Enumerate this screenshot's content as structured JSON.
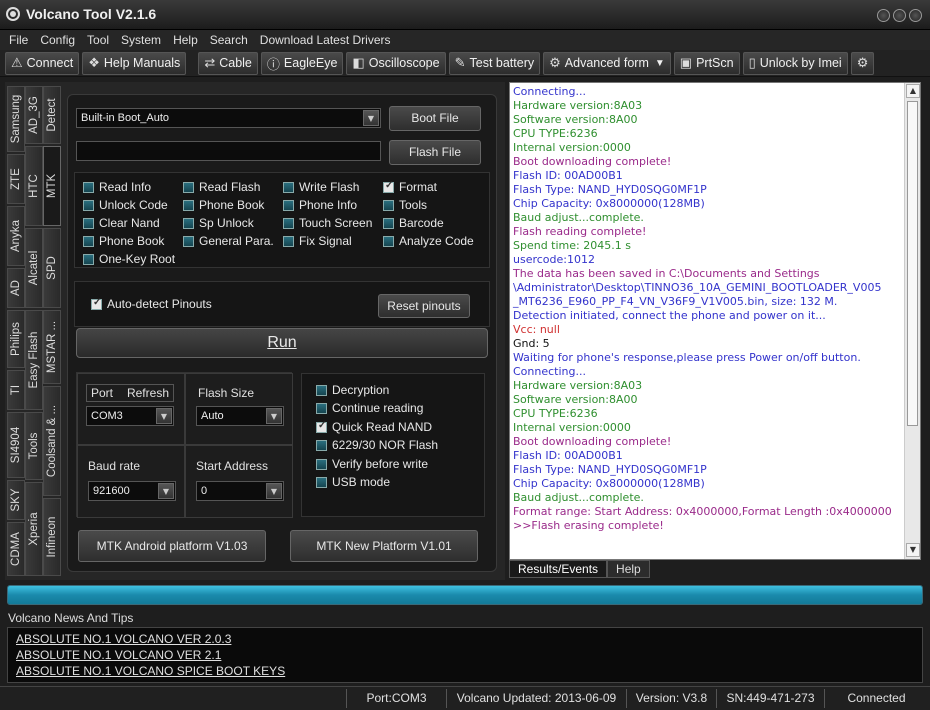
{
  "window": {
    "title": "Volcano Tool V2.1.6"
  },
  "menu": [
    "File",
    "Config",
    "Tool",
    "System",
    "Help",
    "Search",
    "Download Latest Drivers"
  ],
  "toolbar": {
    "connect": "Connect",
    "help_manuals": "Help Manuals",
    "cable": "Cable",
    "eagleeye": "EagleEye",
    "oscilloscope": "Oscilloscope",
    "test_battery": "Test battery",
    "advanced_form": "Advanced form",
    "prtscn": "PrtScn",
    "unlock_imei": "Unlock by Imei"
  },
  "side_tabs": {
    "col1": [
      "Samsung",
      "ZTE",
      "Anyka",
      "AD",
      "Philips",
      "TI",
      "SI4904",
      "SKY",
      "CDMA"
    ],
    "col2": [
      "AD_3G",
      "HTC",
      "Alcatel",
      "Easy Flash",
      "Tools",
      "Xperia"
    ],
    "col3": [
      "Detect",
      "MTK",
      "SPD",
      "MSTAR ...",
      "Coolsand & ...",
      "Infineon"
    ]
  },
  "boot": {
    "selected": "Built-in Boot_Auto",
    "boot_file": "Boot File",
    "flash_file": "Flash File",
    "flash_path": ""
  },
  "functions": [
    {
      "label": "Read Info",
      "checked": false
    },
    {
      "label": "Read Flash",
      "checked": false
    },
    {
      "label": "Write Flash",
      "checked": false
    },
    {
      "label": "Format",
      "checked": true
    },
    {
      "label": "Unlock Code",
      "checked": false
    },
    {
      "label": "Phone Book",
      "checked": false
    },
    {
      "label": "Phone Info",
      "checked": false
    },
    {
      "label": "Tools",
      "checked": false
    },
    {
      "label": "Clear Nand",
      "checked": false
    },
    {
      "label": "Sp Unlock",
      "checked": false
    },
    {
      "label": "Touch Screen",
      "checked": false
    },
    {
      "label": "Barcode",
      "checked": false
    },
    {
      "label": "Phone Book",
      "checked": false
    },
    {
      "label": "General Para.",
      "checked": false
    },
    {
      "label": "Fix Signal",
      "checked": false
    },
    {
      "label": "Analyze Code",
      "checked": false
    },
    {
      "label": "One-Key Root",
      "checked": false
    }
  ],
  "pinouts": {
    "label": "Auto-detect Pinouts",
    "checked": true,
    "reset": "Reset pinouts"
  },
  "run_label": "Run",
  "port": {
    "port_label": "Port",
    "refresh_label": "Refresh",
    "value": "COM3"
  },
  "flash_size": {
    "label": "Flash Size",
    "value": "Auto"
  },
  "baud": {
    "label": "Baud rate",
    "value": "921600"
  },
  "start_address": {
    "label": "Start Address",
    "value": "0"
  },
  "options": [
    {
      "label": "Decryption",
      "checked": false
    },
    {
      "label": "Continue reading",
      "checked": false
    },
    {
      "label": "Quick Read NAND",
      "checked": true
    },
    {
      "label": "6229/30 NOR Flash",
      "checked": false
    },
    {
      "label": "Verify before write",
      "checked": false
    },
    {
      "label": "USB mode",
      "checked": false
    }
  ],
  "platform_buttons": {
    "android": "MTK Android platform V1.03",
    "new": "MTK New Platform V1.01"
  },
  "log": [
    {
      "t": "Connecting...",
      "c": "blue"
    },
    {
      "t": "Hardware version:8A03",
      "c": "green"
    },
    {
      "t": "Software version:8A00",
      "c": "green"
    },
    {
      "t": "CPU TYPE:6236",
      "c": "green"
    },
    {
      "t": "Internal version:0000",
      "c": "green"
    },
    {
      "t": "Boot downloading complete!",
      "c": "purple"
    },
    {
      "t": "Flash ID: 00AD00B1",
      "c": "blue"
    },
    {
      "t": "Flash Type: NAND_HYD0SQG0MF1P",
      "c": "blue"
    },
    {
      "t": "Chip Capacity: 0x8000000(128MB)",
      "c": "blue"
    },
    {
      "t": "Baud adjust...complete.",
      "c": "green"
    },
    {
      "t": "Flash reading complete!",
      "c": "purple"
    },
    {
      "t": "Spend time: 2045.1 s",
      "c": "green"
    },
    {
      "t": "usercode:1012",
      "c": "blue"
    },
    {
      "t": " The data has been saved in C:\\Documents and Settings",
      "c": "purple"
    },
    {
      "t": "\\Administrator\\Desktop\\TINNO36_10A_GEMINI_BOOTLOADER_V005",
      "c": "blue"
    },
    {
      "t": "_MT6236_E960_PP_F4_VN_V36F9_V1V005.bin, size: 132 M.",
      "c": "blue"
    },
    {
      "t": " Detection initiated, connect the phone and power on it...",
      "c": "blue"
    },
    {
      "t": "Vcc: null",
      "c": "red"
    },
    {
      "t": "Gnd: 5",
      "c": "black"
    },
    {
      "t": "Waiting for phone's response,please press Power on/off button.",
      "c": "blue"
    },
    {
      "t": "Connecting...",
      "c": "blue"
    },
    {
      "t": "Hardware version:8A03",
      "c": "green"
    },
    {
      "t": "Software version:8A00",
      "c": "green"
    },
    {
      "t": "CPU TYPE:6236",
      "c": "green"
    },
    {
      "t": "Internal version:0000",
      "c": "green"
    },
    {
      "t": "Boot downloading complete!",
      "c": "purple"
    },
    {
      "t": "Flash ID: 00AD00B1",
      "c": "blue"
    },
    {
      "t": "Flash Type: NAND_HYD0SQG0MF1P",
      "c": "blue"
    },
    {
      "t": "Chip Capacity: 0x8000000(128MB)",
      "c": "blue"
    },
    {
      "t": "Baud adjust...complete.",
      "c": "green"
    },
    {
      "t": "Format range: Start Address: 0x4000000,Format Length :0x4000000",
      "c": "purple"
    },
    {
      "t": ">>Flash erasing complete!",
      "c": "purple"
    }
  ],
  "log_tabs": [
    "Results/Events",
    "Help"
  ],
  "progress": 100,
  "news": {
    "title": "Volcano News And Tips",
    "links": [
      "ABSOLUTE NO.1 VOLCANO VER 2.0.3",
      "ABSOLUTE NO.1 VOLCANO VER 2.1",
      "ABSOLUTE NO.1 VOLCANO SPICE BOOT KEYS"
    ]
  },
  "status": {
    "port": "Port:COM3",
    "updated": "Volcano Updated: 2013-06-09",
    "version": "Version: V3.8",
    "sn": "SN:449-471-273",
    "state": "Connected"
  },
  "colors": {
    "progress": "#2aa8cc",
    "log_bg": "#ffffff",
    "panel_bg": "#1a1a1a"
  }
}
